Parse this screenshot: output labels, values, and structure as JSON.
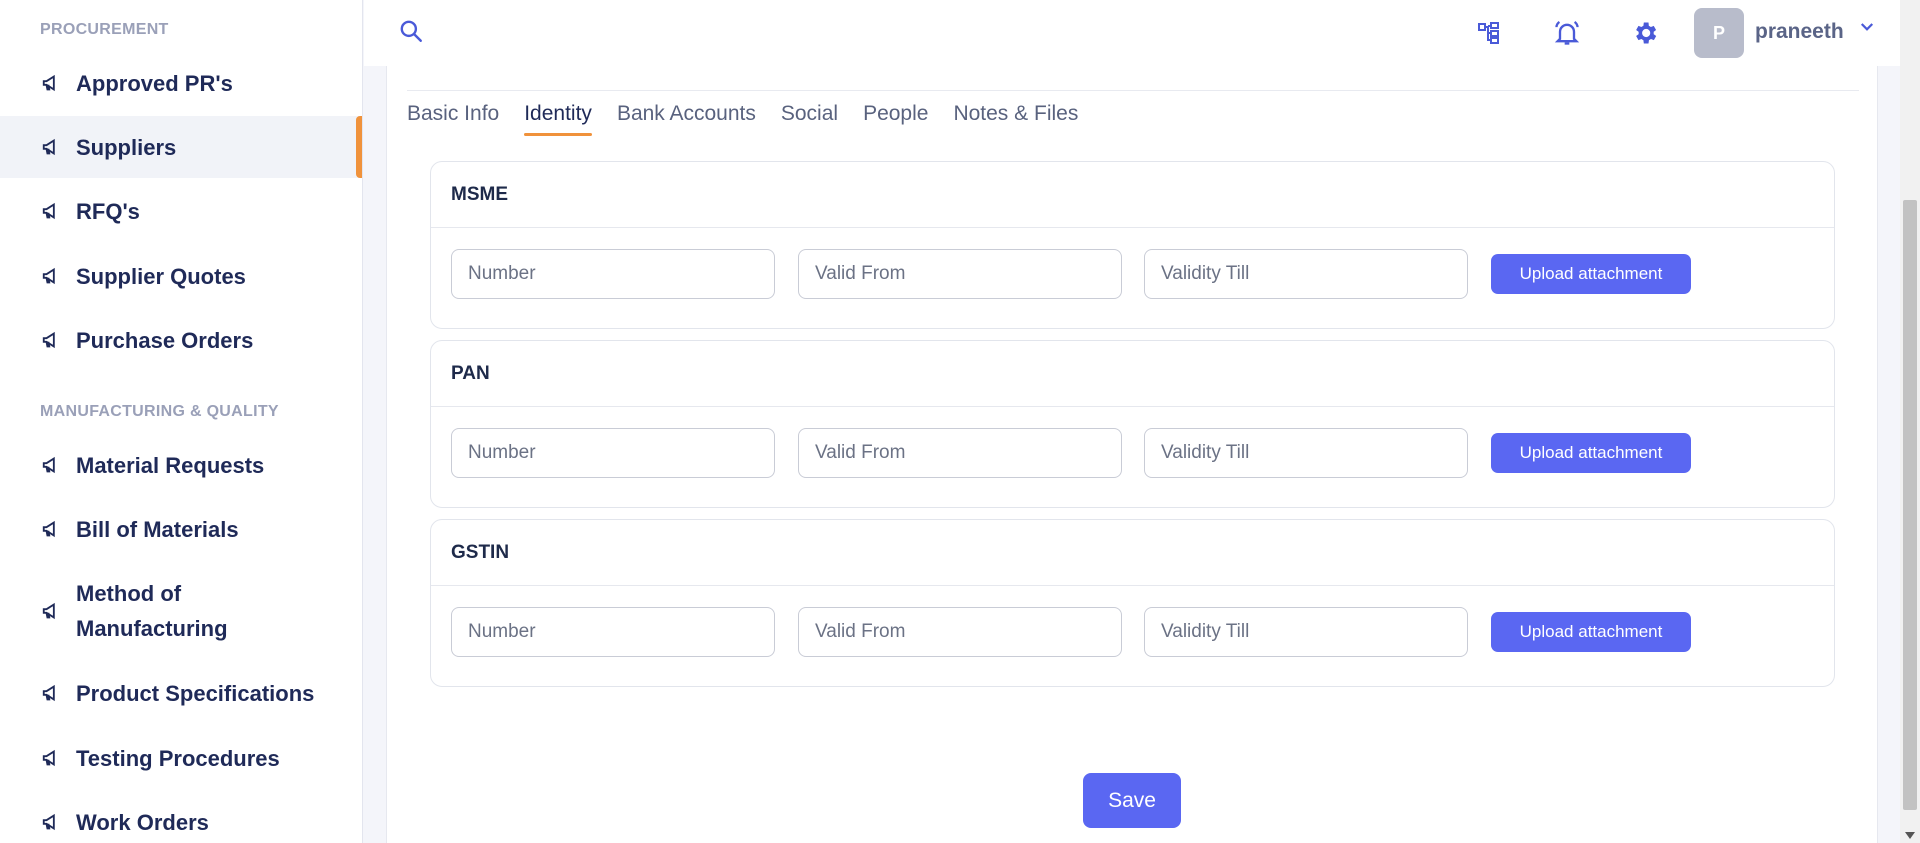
{
  "sidebar": {
    "sections": [
      {
        "title": "PROCUREMENT",
        "items": [
          {
            "label": "Approved PR's",
            "icon": "megaphone-icon"
          },
          {
            "label": "Suppliers",
            "icon": "megaphone-icon",
            "active": true
          },
          {
            "label": "RFQ's",
            "icon": "megaphone-icon"
          },
          {
            "label": "Supplier Quotes",
            "icon": "megaphone-icon"
          },
          {
            "label": "Purchase Orders",
            "icon": "megaphone-icon"
          }
        ]
      },
      {
        "title": "MANUFACTURING & QUALITY",
        "items": [
          {
            "label": "Material Requests",
            "icon": "megaphone-icon"
          },
          {
            "label": "Bill of Materials",
            "icon": "megaphone-icon"
          },
          {
            "label": "Method of Manufacturing",
            "icon": "megaphone-icon"
          },
          {
            "label": "Product Specifications",
            "icon": "megaphone-icon"
          },
          {
            "label": "Testing Procedures",
            "icon": "megaphone-icon"
          },
          {
            "label": "Work Orders",
            "icon": "megaphone-icon"
          }
        ]
      }
    ]
  },
  "topbar": {
    "icons": [
      "search-icon",
      "hierarchy-icon",
      "bell-icon",
      "gear-icon",
      "chevron-down-icon"
    ],
    "user": {
      "initial": "P",
      "name": "praneeth"
    }
  },
  "tabs": [
    {
      "label": "Basic Info",
      "active": false
    },
    {
      "label": "Identity",
      "active": true
    },
    {
      "label": "Bank Accounts",
      "active": false
    },
    {
      "label": "Social",
      "active": false
    },
    {
      "label": "People",
      "active": false
    },
    {
      "label": "Notes & Files",
      "active": false
    }
  ],
  "identity_panels": [
    {
      "title": "MSME",
      "number_placeholder": "Number",
      "valid_from_placeholder": "Valid From",
      "validity_till_placeholder": "Validity Till",
      "upload_label": "Upload attachment"
    },
    {
      "title": "PAN",
      "number_placeholder": "Number",
      "valid_from_placeholder": "Valid From",
      "validity_till_placeholder": "Validity Till",
      "upload_label": "Upload attachment"
    },
    {
      "title": "GSTIN",
      "number_placeholder": "Number",
      "valid_from_placeholder": "Valid From",
      "validity_till_placeholder": "Validity Till",
      "upload_label": "Upload attachment"
    }
  ],
  "save_label": "Save",
  "colors": {
    "accent": "#5a67f2",
    "active_indicator": "#f0923b",
    "nav_text": "#1f2a58",
    "icon": "#4a5ad8"
  }
}
